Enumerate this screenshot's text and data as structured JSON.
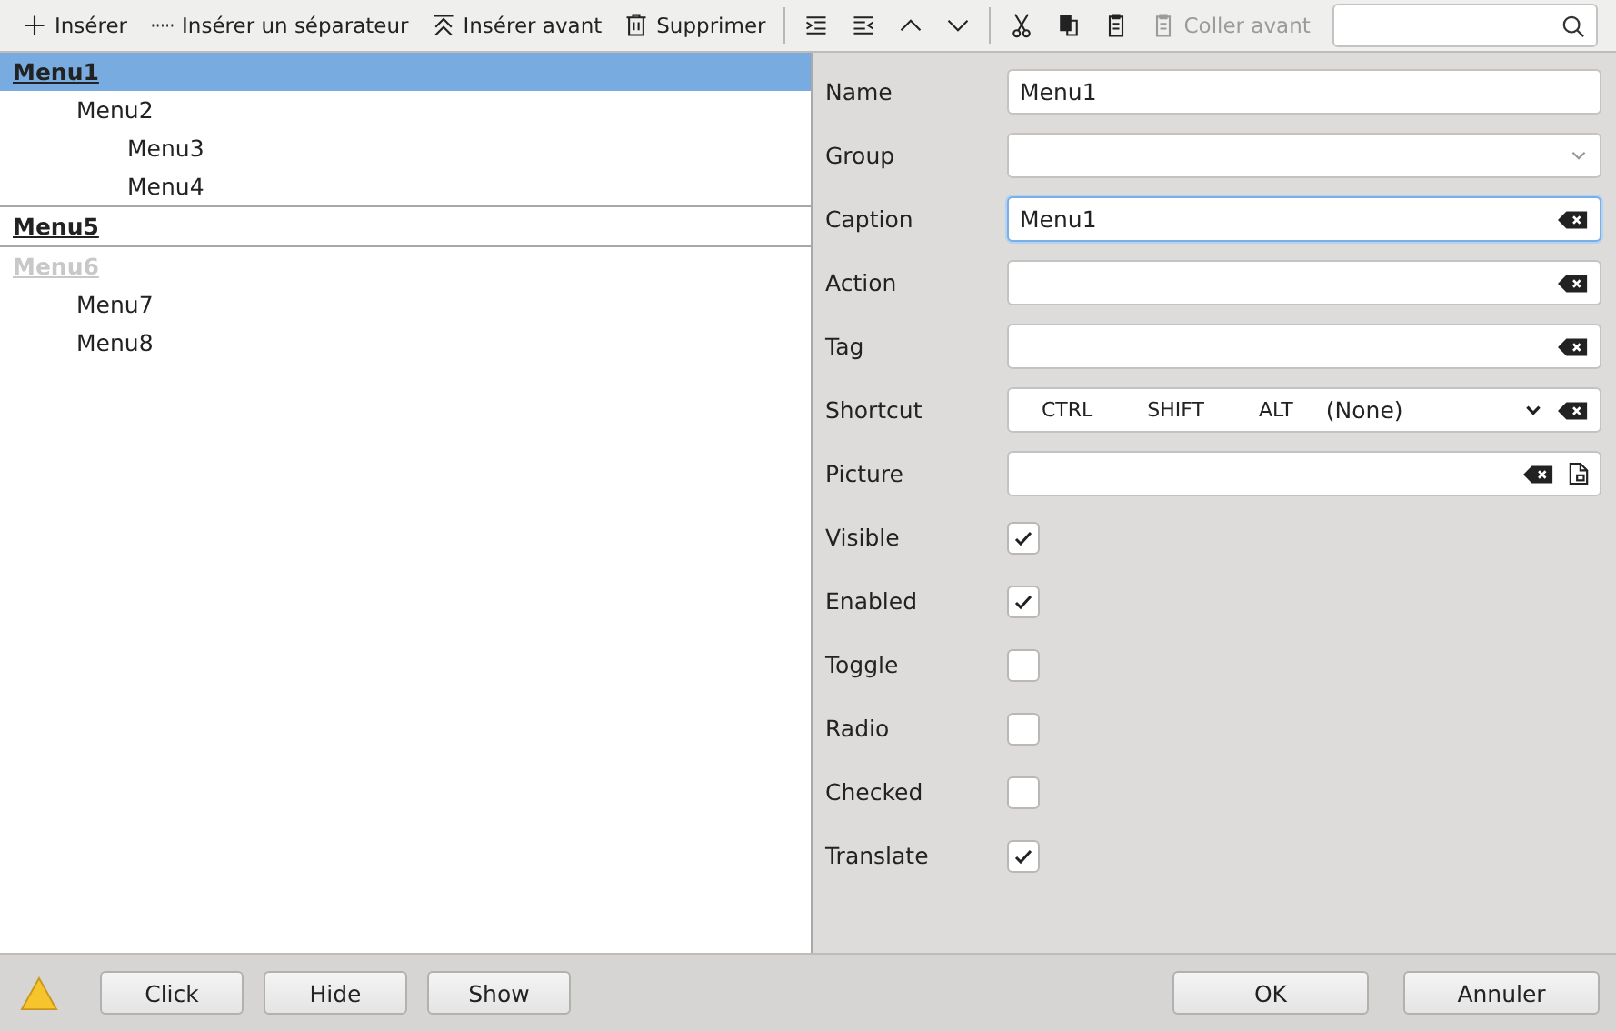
{
  "toolbar": [
    {
      "kind": "text",
      "label": "Insérer",
      "disabled": false
    },
    {
      "kind": "text",
      "label": "Insérer un séparateur",
      "disabled": false
    },
    {
      "kind": "text",
      "label": "Insérer avant",
      "disabled": false
    },
    {
      "kind": "text",
      "label": "Supprimer",
      "disabled": false
    },
    {
      "kind": "divider"
    },
    {
      "kind": "icon",
      "disabled": false
    },
    {
      "kind": "icon",
      "disabled": false
    },
    {
      "kind": "icon",
      "disabled": false
    },
    {
      "kind": "icon",
      "disabled": false
    },
    {
      "kind": "divider"
    },
    {
      "kind": "icon",
      "disabled": false
    },
    {
      "kind": "icon",
      "disabled": false
    },
    {
      "kind": "icon",
      "disabled": false
    },
    {
      "kind": "text",
      "label": "Coller avant",
      "disabled": true
    }
  ],
  "tree": [
    {
      "kind": "item",
      "label": "Menu1",
      "selected": true,
      "disabled": false,
      "children": [
        {
          "label": "Menu2",
          "selected": false,
          "disabled": false,
          "children": [
            {
              "label": "Menu3",
              "selected": false,
              "disabled": false
            },
            {
              "label": "Menu4",
              "selected": false,
              "disabled": false
            }
          ]
        }
      ]
    },
    {
      "kind": "separator"
    },
    {
      "kind": "item",
      "label": "Menu5",
      "selected": false,
      "disabled": false
    },
    {
      "kind": "separator"
    },
    {
      "kind": "item",
      "label": "Menu6",
      "selected": false,
      "disabled": true,
      "children": [
        {
          "label": "Menu7",
          "selected": false,
          "disabled": false
        },
        {
          "label": "Menu8",
          "selected": false,
          "disabled": false
        }
      ]
    }
  ],
  "properties": [
    {
      "kind": "text",
      "label": "Name",
      "value": "Menu1",
      "focused": false
    },
    {
      "kind": "combo",
      "label": "Group",
      "focused": false
    },
    {
      "kind": "clear",
      "label": "Caption",
      "value": "Menu1",
      "focused": true
    },
    {
      "kind": "clear",
      "label": "Action",
      "focused": false
    },
    {
      "kind": "clear",
      "label": "Tag",
      "focused": false
    },
    {
      "kind": "shortcut",
      "label": "Shortcut",
      "keys": [
        "CTRL",
        "SHIFT",
        "ALT"
      ],
      "value": "(None)",
      "focused": false
    },
    {
      "kind": "picture",
      "label": "Picture",
      "focused": false
    },
    {
      "kind": "check",
      "label": "Visible",
      "checked": true
    },
    {
      "kind": "check",
      "label": "Enabled",
      "checked": true
    },
    {
      "kind": "check",
      "label": "Toggle",
      "checked": false
    },
    {
      "kind": "check",
      "label": "Radio",
      "checked": false
    },
    {
      "kind": "check",
      "label": "Checked",
      "checked": false
    },
    {
      "kind": "check",
      "label": "Translate",
      "checked": true
    }
  ],
  "footer": {
    "left_buttons": [
      "Click",
      "Hide",
      "Show"
    ],
    "right_buttons": [
      "OK",
      "Annuler"
    ]
  }
}
